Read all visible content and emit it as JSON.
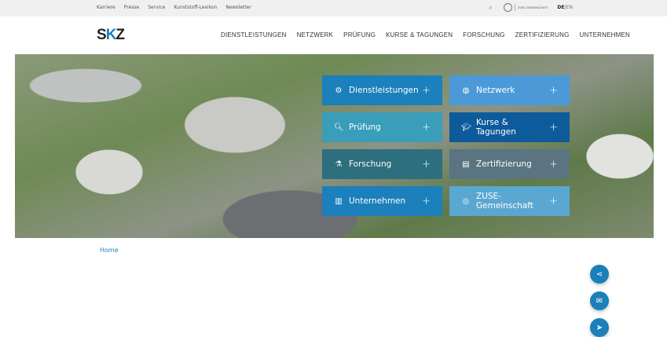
{
  "topbar": {
    "links": [
      "Karriere",
      "Presse",
      "Service",
      "Kunststoff-Lexikon",
      "Newsletter"
    ],
    "zuse_label": "ZUSE-GEMEINSCHAFT",
    "lang_active": "DE",
    "lang_sep": "|",
    "lang_other": "EN"
  },
  "logo": {
    "text_a": "S",
    "text_b": "K",
    "text_c": "Z"
  },
  "nav": [
    "DIENSTLEISTUNGEN",
    "NETZWERK",
    "PRÜFUNG",
    "KURSE & TAGUNGEN",
    "FORSCHUNG",
    "ZERTIFIZIERUNG",
    "UNTERNEHMEN"
  ],
  "tiles": [
    {
      "label": "Dienstleistungen",
      "icon": "gear-icon",
      "color": "#1b80bb"
    },
    {
      "label": "Netzwerk",
      "icon": "network-globe-icon",
      "color": "#4b9ad7"
    },
    {
      "label": "Prüfung",
      "icon": "search-icon",
      "color": "#3a9db9"
    },
    {
      "label": "Kurse & Tagungen",
      "icon": "graduation-cap-icon",
      "color": "#0d5b9b"
    },
    {
      "label": "Forschung",
      "icon": "microscope-icon",
      "color": "#2d6f7f"
    },
    {
      "label": "Zertifizierung",
      "icon": "certificate-icon",
      "color": "#5a7481"
    },
    {
      "label": "Unternehmen",
      "icon": "building-icon",
      "color": "#1b80bb"
    },
    {
      "label": "ZUSE-Gemeinschaft",
      "icon": "zuse-icon",
      "color": "#5aa7d1"
    }
  ],
  "tile_plus": "+",
  "breadcrumb": {
    "home": "Home"
  },
  "fabs": [
    "share-icon",
    "mail-icon",
    "send-icon"
  ]
}
